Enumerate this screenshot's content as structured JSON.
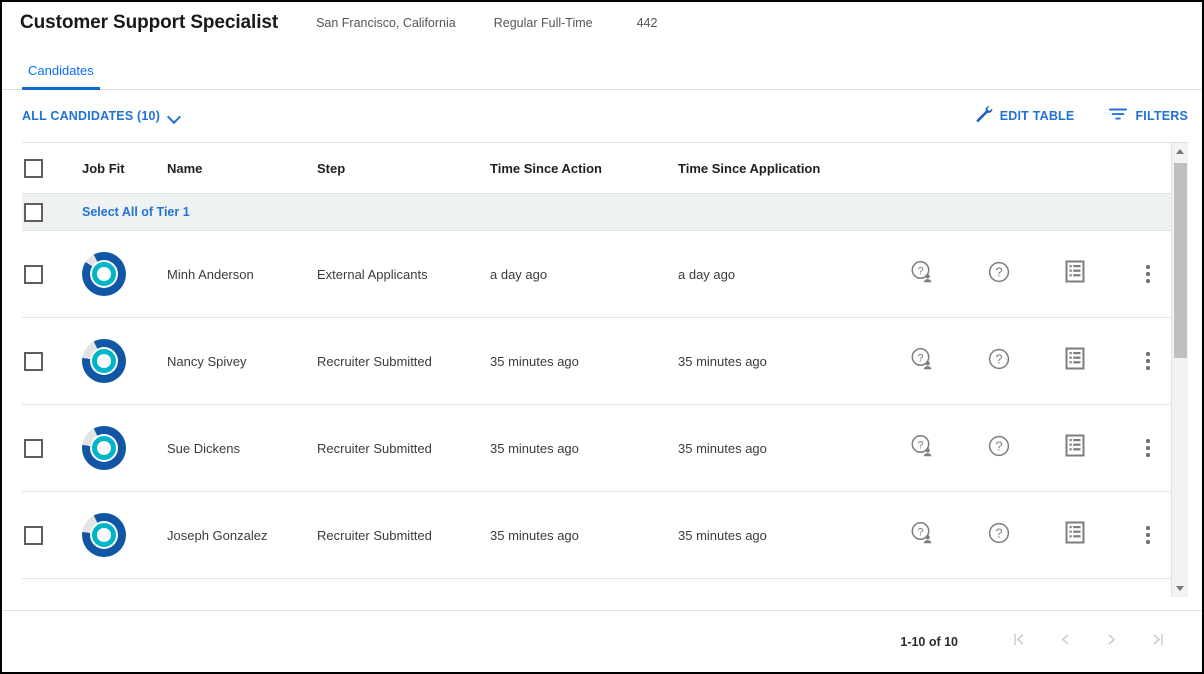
{
  "header": {
    "job_title": "Customer Support Specialist",
    "location": "San Francisco, California",
    "employment_type": "Regular Full-Time",
    "requisition_id": "442"
  },
  "tabs": [
    {
      "label": "Candidates",
      "active": true
    }
  ],
  "toolbar": {
    "all_candidates_label": "ALL CANDIDATES (10)",
    "dropdown_icon": "chevron-down-icon",
    "edit_table_label": "EDIT TABLE",
    "edit_table_icon": "wrench-icon",
    "filters_label": "FILTERS",
    "filters_icon": "filter-icon"
  },
  "table": {
    "columns": [
      "Job Fit",
      "Name",
      "Step",
      "Time Since Action",
      "Time Since Application"
    ],
    "group_row_label": "Select All of Tier 1",
    "rows": [
      {
        "job_fit_icon": "job-fit-donut",
        "job_fit_percent": 92,
        "name": "Minh Anderson",
        "step": "External Applicants",
        "time_since_action": "a day ago",
        "time_since_application": "a day ago",
        "actions": [
          "question-person-icon",
          "question-circle-icon",
          "document-list-icon",
          "more-options-icon"
        ]
      },
      {
        "job_fit_icon": "job-fit-donut",
        "job_fit_percent": 85,
        "name": "Nancy Spivey",
        "step": "Recruiter Submitted",
        "time_since_action": "35 minutes ago",
        "time_since_application": "35 minutes ago",
        "actions": [
          "question-person-icon",
          "question-circle-icon",
          "document-list-icon",
          "more-options-icon"
        ]
      },
      {
        "job_fit_icon": "job-fit-donut",
        "job_fit_percent": 85,
        "name": "Sue Dickens",
        "step": "Recruiter Submitted",
        "time_since_action": "35 minutes ago",
        "time_since_application": "35 minutes ago",
        "actions": [
          "question-person-icon",
          "question-circle-icon",
          "document-list-icon",
          "more-options-icon"
        ]
      },
      {
        "job_fit_icon": "job-fit-donut",
        "job_fit_percent": 85,
        "name": "Joseph Gonzalez",
        "step": "Recruiter Submitted",
        "time_since_action": "35 minutes ago",
        "time_since_application": "35 minutes ago",
        "actions": [
          "question-person-icon",
          "question-circle-icon",
          "document-list-icon",
          "more-options-icon"
        ]
      }
    ]
  },
  "pagination": {
    "range_label": "1-10 of 10",
    "first_icon": "first-page-icon",
    "prev_icon": "previous-page-icon",
    "next_icon": "next-page-icon",
    "last_icon": "last-page-icon"
  },
  "colors": {
    "accent_blue": "#2272d6",
    "tab_underline": "#1169d4",
    "donut_outer": "#1156a5",
    "donut_inner": "#00b5c8",
    "donut_track": "#e3e3e3",
    "group_row_bg": "#eef2f3",
    "icon_gray": "#808080"
  }
}
